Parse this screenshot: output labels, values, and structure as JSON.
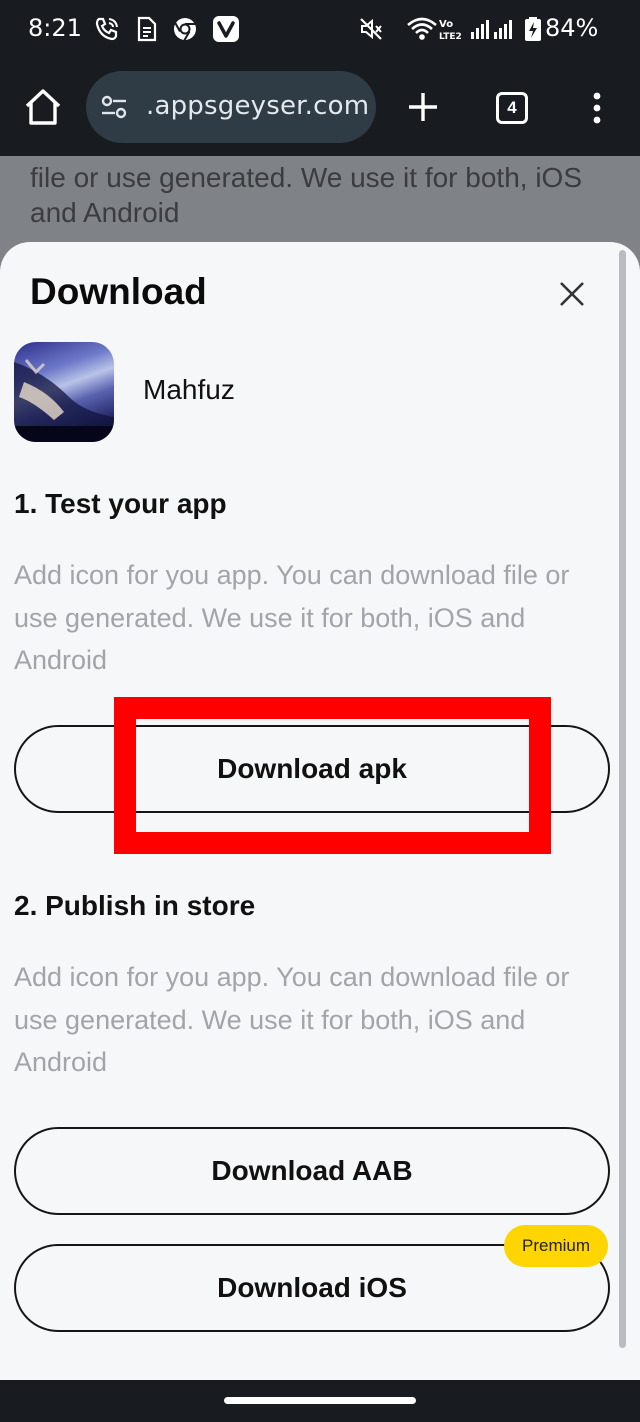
{
  "status_bar": {
    "time": "8:21",
    "battery_percent": "84%",
    "icons": [
      "wifi-calling-icon",
      "document-icon",
      "chrome-icon",
      "vivaldi-icon",
      "mute-icon",
      "wifi-icon",
      "volte-icon",
      "signal-icon",
      "battery-charging-icon"
    ]
  },
  "browser": {
    "url": ".appsgeyser.com",
    "tab_count": "4"
  },
  "background_page": {
    "text": "file or use generated. We use it for both, iOS and Android"
  },
  "sheet": {
    "title": "Download",
    "app_name": "Mahfuz",
    "section1": {
      "title": "1. Test your app",
      "description": "Add icon for you app. You can download file or use generated. We use it for both, iOS and Android",
      "button_label": "Download apk"
    },
    "section2": {
      "title": "2. Publish in store",
      "description": "Add icon for you app. You can download file or use generated. We use it for both, iOS and Android",
      "aab_label": "Download AAB",
      "ios_label": "Download iOS",
      "premium_badge": "Premium"
    }
  },
  "colors": {
    "highlight": "#ff0000",
    "premium": "#ffd500",
    "system_bar": "#181c20"
  }
}
